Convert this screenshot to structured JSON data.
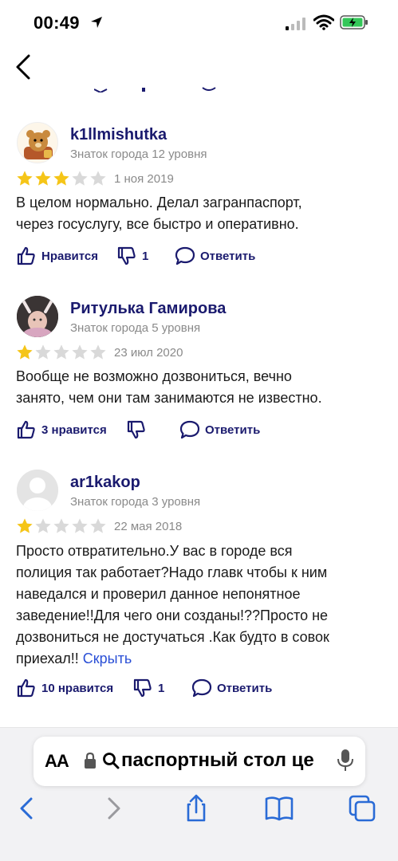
{
  "status_bar": {
    "time": "00:49"
  },
  "colors": {
    "accent": "#1a1a6e",
    "link": "#2a4fd6",
    "star_filled": "#f5c518",
    "star_empty": "#d9d9d9",
    "browser_blue": "#2a6bd6"
  },
  "reviews": [
    {
      "name": "k1llmishutka",
      "level": "Знаток города 12 уровня",
      "rating": 3,
      "date": "1 ноя 2019",
      "text_lines": [
        "В целом нормально. Делал загранпаспорт,",
        "через госуслугу, все быстро и оперативно."
      ],
      "like_label": "Нравится",
      "dislike_count": "1",
      "reply_label": "Ответить"
    },
    {
      "name": "Ритулька Гамирова",
      "level": "Знаток города 5 уровня",
      "rating": 1,
      "date": "23 июл 2020",
      "text_lines": [
        "Вообще не возможно дозвониться, вечно",
        "занято, чем они там занимаются не известно."
      ],
      "like_label": "3 нравится",
      "reply_label": "Ответить"
    },
    {
      "name": "ar1kakop",
      "level": "Знаток города 3 уровня",
      "rating": 1,
      "date": "22 мая 2018",
      "text_lines": [
        "Просто отвратительно.У вас в городе вся",
        "полиция так работает?Надо главк чтобы к ним",
        "наведался и проверил данное непонятное",
        "заведение!!Для чего они созданы!??Просто не",
        "дозвониться не достучаться .Как будто в совок",
        "приехал!! "
      ],
      "hide_label": "Скрыть",
      "like_label": "10 нравится",
      "dislike_count": "1",
      "reply_label": "Ответить"
    }
  ],
  "browser": {
    "aa_label": "AA",
    "address": "паспортный стол це"
  }
}
